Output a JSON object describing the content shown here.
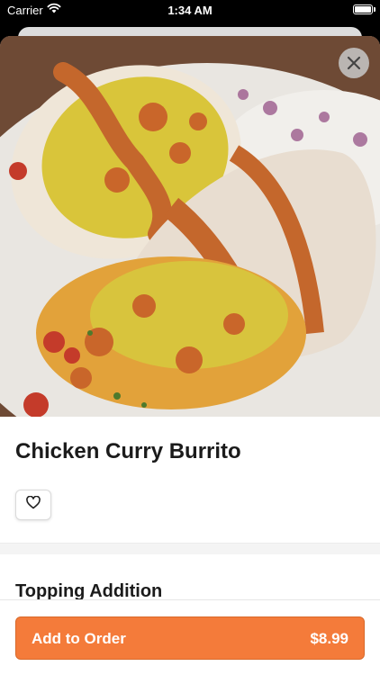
{
  "status_bar": {
    "carrier": "Carrier",
    "time": "1:34 AM"
  },
  "item": {
    "name": "Chicken Curry Burrito",
    "image_icon": "burrito-photo"
  },
  "sections": {
    "topping_title": "Topping Addition"
  },
  "order": {
    "button_label": "Add to Order",
    "price": "$8.99",
    "accent_color": "#f47b3a"
  },
  "icons": {
    "close": "close-icon",
    "favorite": "heart-outline-icon",
    "wifi": "wifi-icon",
    "battery": "battery-icon"
  }
}
